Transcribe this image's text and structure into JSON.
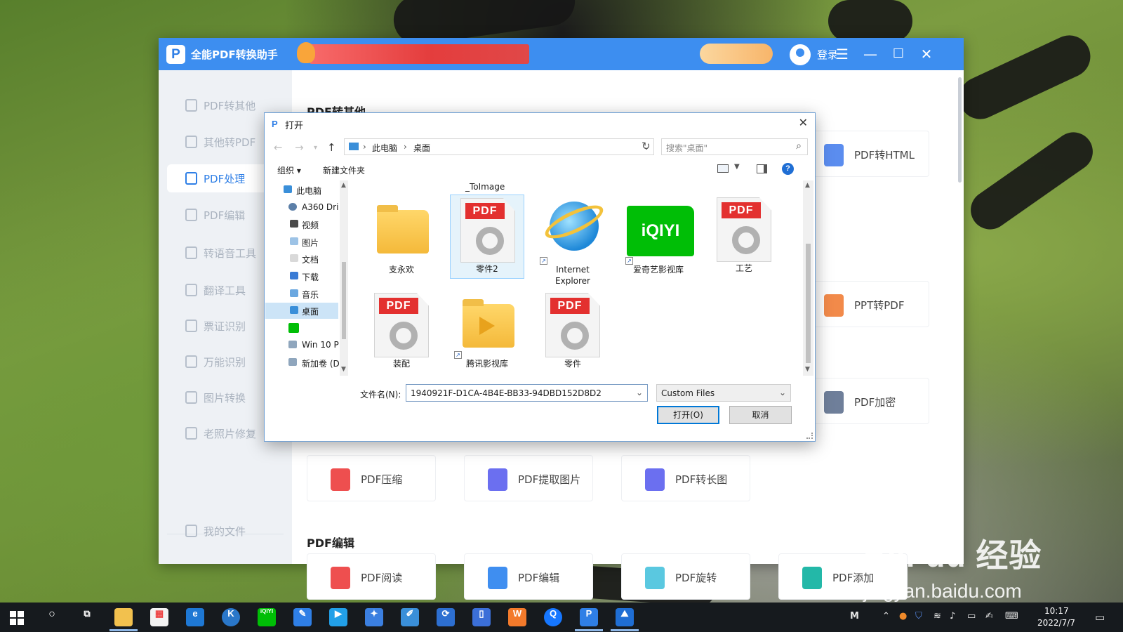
{
  "app": {
    "title": "全能PDF转换助手",
    "login": "登录",
    "sidebar": [
      {
        "label": "PDF转其他"
      },
      {
        "label": "其他转PDF"
      },
      {
        "label": "PDF处理"
      },
      {
        "label": "PDF编辑"
      },
      {
        "label": "转语音工具"
      },
      {
        "label": "翻译工具"
      },
      {
        "label": "票证识别"
      },
      {
        "label": "万能识别"
      },
      {
        "label": "图片转换"
      },
      {
        "label": "老照片修复"
      },
      {
        "label": "我的文件"
      }
    ],
    "active_sidebar": "PDF处理",
    "section_top": "PDF转其他",
    "cards_right": [
      "PDF转HTML",
      "PPT转PDF",
      "PDF加密"
    ],
    "cards_row": [
      "PDF压缩",
      "PDF提取图片",
      "PDF转长图"
    ],
    "section_bottom": "PDF编辑",
    "cards_bottom": [
      "PDF阅读",
      "PDF编辑",
      "PDF旋转",
      "PDF添加"
    ]
  },
  "dialog": {
    "title": "打开",
    "breadcrumb": [
      "此电脑",
      "桌面"
    ],
    "search_placeholder": "搜索\"桌面\"",
    "toolbar": {
      "organize": "组织 ▾",
      "new_folder": "新建文件夹"
    },
    "tree": [
      {
        "label": "此电脑",
        "icon": "pc-icon"
      },
      {
        "label": "A360 Dri",
        "icon": "cloud-drive-icon"
      },
      {
        "label": "视频",
        "icon": "video-folder-icon"
      },
      {
        "label": "图片",
        "icon": "pictures-folder-icon"
      },
      {
        "label": "文档",
        "icon": "documents-folder-icon"
      },
      {
        "label": "下载",
        "icon": "downloads-folder-icon"
      },
      {
        "label": "音乐",
        "icon": "music-folder-icon"
      },
      {
        "label": "桌面",
        "icon": "desktop-folder-icon"
      },
      {
        "label": "",
        "icon": "iqiyi-icon"
      },
      {
        "label": "Win 10 P",
        "icon": "drive-icon"
      },
      {
        "label": "新加卷 (D",
        "icon": "drive-icon"
      }
    ],
    "selected_tree": "桌面",
    "partial_label": "_ToImage",
    "files": [
      {
        "label": "支永欢",
        "kind": "folder-docs"
      },
      {
        "label": "零件2",
        "kind": "pdf"
      },
      {
        "label": "Internet Explorer",
        "kind": "ie"
      },
      {
        "label": "爱奇艺影视库",
        "kind": "iqiyi"
      },
      {
        "label": "工艺",
        "kind": "pdf"
      },
      {
        "label": "装配",
        "kind": "pdf"
      },
      {
        "label": "腾讯影视库",
        "kind": "folder-video"
      },
      {
        "label": "零件",
        "kind": "pdf"
      }
    ],
    "selected_file": "零件2",
    "pdf_tag": "PDF",
    "iqiyi_tag": "iQIYI",
    "filename_label": "文件名(N):",
    "filename_value": "1940921F-D1CA-4B4E-BB33-94DBD152D8D2",
    "filetype": "Custom Files",
    "open_button": "打开(O)",
    "cancel_button": "取消"
  },
  "taskbar": {
    "time": "10:17",
    "date": "2022/7/7",
    "tray_ime": "M"
  },
  "watermark": {
    "brand": "Bai du 经验",
    "url": "jingyan.baidu.com"
  },
  "colors": {
    "accent": "#3d8ef0",
    "pdf_red": "#e3302f",
    "dialog_border": "#6d9fd4"
  }
}
